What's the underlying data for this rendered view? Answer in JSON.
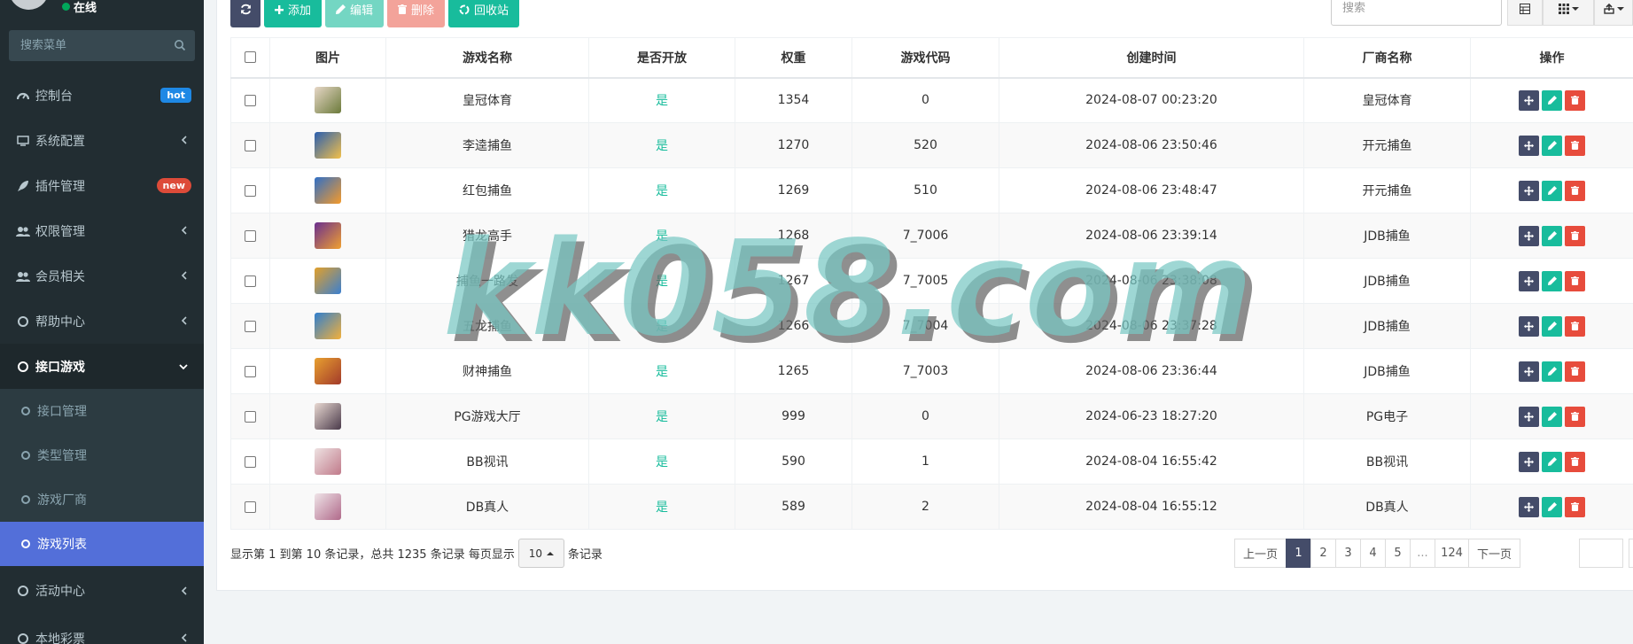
{
  "sidebar": {
    "status": "在线",
    "search_placeholder": "搜索菜单",
    "menu": [
      {
        "label": "控制台",
        "icon": "dashboard-icon",
        "badge": "hot"
      },
      {
        "label": "系统配置",
        "icon": "desktop-icon"
      },
      {
        "label": "插件管理",
        "icon": "rocket-icon",
        "badge": "new"
      },
      {
        "label": "权限管理",
        "icon": "users-icon"
      },
      {
        "label": "会员相关",
        "icon": "users-icon"
      },
      {
        "label": "帮助中心",
        "icon": "circle-icon"
      },
      {
        "label": "接口游戏",
        "icon": "circle-icon",
        "expanded": true
      }
    ],
    "submenu": [
      {
        "label": "接口管理"
      },
      {
        "label": "类型管理"
      },
      {
        "label": "游戏厂商"
      },
      {
        "label": "游戏列表",
        "active": true
      }
    ],
    "menu_after": [
      {
        "label": "活动中心",
        "icon": "circle-icon"
      },
      {
        "label": "本地彩票",
        "icon": "circle-icon"
      }
    ]
  },
  "toolbar": {
    "add_label": "添加",
    "edit_label": "编辑",
    "delete_label": "删除",
    "recycle_label": "回收站",
    "search_placeholder": "搜索"
  },
  "table": {
    "headers": [
      "图片",
      "游戏名称",
      "是否开放",
      "权重",
      "游戏代码",
      "创建时间",
      "厂商名称",
      "操作"
    ],
    "rows": [
      {
        "name": "皇冠体育",
        "open": "是",
        "weight": "1354",
        "code": "0",
        "created": "2024-08-07 00:23:20",
        "vendor": "皇冠体育"
      },
      {
        "name": "李逵捕鱼",
        "open": "是",
        "weight": "1270",
        "code": "520",
        "created": "2024-08-06 23:50:46",
        "vendor": "开元捕鱼"
      },
      {
        "name": "红包捕鱼",
        "open": "是",
        "weight": "1269",
        "code": "510",
        "created": "2024-08-06 23:48:47",
        "vendor": "开元捕鱼"
      },
      {
        "name": "猎龙高手",
        "open": "是",
        "weight": "1268",
        "code": "7_7006",
        "created": "2024-08-06 23:39:14",
        "vendor": "JDB捕鱼"
      },
      {
        "name": "捕鱼一路发",
        "open": "是",
        "weight": "1267",
        "code": "7_7005",
        "created": "2024-08-06 23:38:08",
        "vendor": "JDB捕鱼"
      },
      {
        "name": "五龙捕鱼",
        "open": "是",
        "weight": "1266",
        "code": "7_7004",
        "created": "2024-08-06 23:37:28",
        "vendor": "JDB捕鱼"
      },
      {
        "name": "财神捕鱼",
        "open": "是",
        "weight": "1265",
        "code": "7_7003",
        "created": "2024-08-06 23:36:44",
        "vendor": "JDB捕鱼"
      },
      {
        "name": "PG游戏大厅",
        "open": "是",
        "weight": "999",
        "code": "0",
        "created": "2024-06-23 18:27:20",
        "vendor": "PG电子"
      },
      {
        "name": "BB视讯",
        "open": "是",
        "weight": "590",
        "code": "1",
        "created": "2024-08-04 16:55:42",
        "vendor": "BB视讯"
      },
      {
        "name": "DB真人",
        "open": "是",
        "weight": "589",
        "code": "2",
        "created": "2024-08-04 16:55:12",
        "vendor": "DB真人"
      }
    ]
  },
  "pagination": {
    "info_prefix": "显示第 1 到第 10 条记录，总共 1235 条记录 每页显示",
    "page_size": "10",
    "info_suffix": "条记录",
    "prev": "上一页",
    "pages": [
      "1",
      "2",
      "3",
      "4",
      "5",
      "...",
      "124"
    ],
    "next": "下一页",
    "current": "1"
  },
  "watermark": "kk058.com",
  "colors": {
    "sidebar_bg": "#222d32",
    "accent_active": "#536fd9",
    "success": "#18bc9c",
    "danger": "#e74c3c",
    "dark_btn": "#444c69"
  }
}
